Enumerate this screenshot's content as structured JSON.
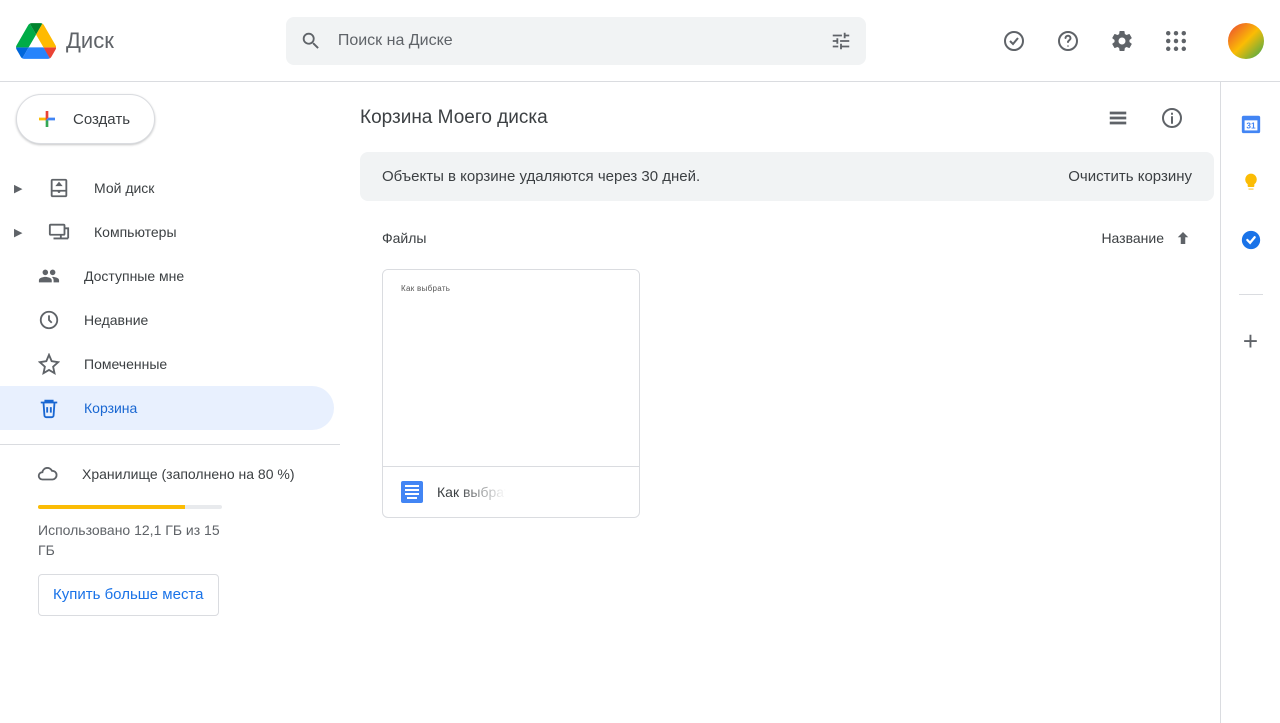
{
  "app": {
    "title": "Диск"
  },
  "search": {
    "placeholder": "Поиск на Диске"
  },
  "sidebar": {
    "create_label": "Создать",
    "items": [
      {
        "label": "Мой диск"
      },
      {
        "label": "Компьютеры"
      },
      {
        "label": "Доступные мне"
      },
      {
        "label": "Недавние"
      },
      {
        "label": "Помеченные"
      },
      {
        "label": "Корзина"
      }
    ],
    "storage": {
      "title": "Хранилище (заполнено на 80 %)",
      "percent": 80,
      "usage_text": "Использовано 12,1 ГБ из 15 ГБ",
      "buy_label": "Купить больше места"
    }
  },
  "main": {
    "title": "Корзина Моего диска",
    "banner": {
      "text": "Объекты в корзине удаляются через 30 дней.",
      "action": "Очистить корзину"
    },
    "section_label": "Файлы",
    "sort_label": "Название"
  },
  "files": [
    {
      "name": "Как выбрать",
      "thumb_text": "Как выбрать"
    }
  ]
}
